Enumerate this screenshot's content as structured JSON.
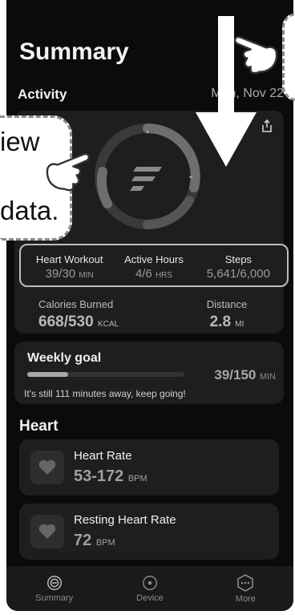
{
  "header": {
    "title": "Summary"
  },
  "activity": {
    "section_title": "Activity",
    "date": "Mon, Nov 22",
    "metrics": [
      {
        "label": "Heart Workout",
        "value": "39/30",
        "unit": "MIN"
      },
      {
        "label": "Active Hours",
        "value": "4/6",
        "unit": "HRS"
      },
      {
        "label": "Steps",
        "value": "5,641/6,000",
        "unit": ""
      }
    ],
    "calories": {
      "label": "Calories Burned",
      "value": "668/530",
      "unit": "KCAL"
    },
    "distance": {
      "label": "Distance",
      "value": "2.8",
      "unit": "MI"
    }
  },
  "weekly_goal": {
    "title": "Weekly goal",
    "value": "39/150",
    "unit": "MIN",
    "progress": 0.26,
    "message": "It's still 111 minutes away, keep going!"
  },
  "heart": {
    "section_title": "Heart",
    "cards": [
      {
        "title": "Heart Rate",
        "value": "53-172",
        "unit": "BPM"
      },
      {
        "title": "Resting Heart Rate",
        "value": "72",
        "unit": "BPM"
      }
    ]
  },
  "nav": {
    "items": [
      "Summary",
      "Device",
      "More"
    ]
  },
  "overlay": {
    "callout_line1": "iew",
    "callout_line2": "data."
  },
  "colors": {
    "ring_track": "#3a3a3a",
    "ring_fill": "#6b6b6b",
    "card_bg": "#1e1e1e",
    "accent": "#bdbdbd"
  }
}
